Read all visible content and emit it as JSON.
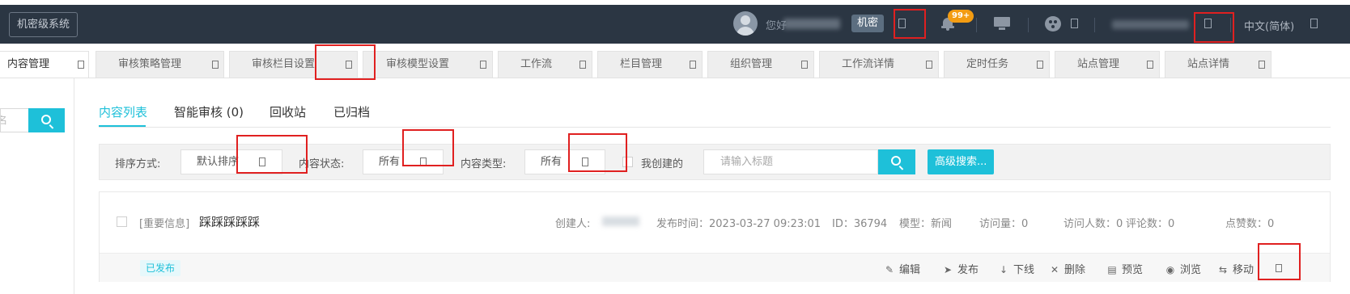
{
  "topbar": {
    "system_button": "机密级系统",
    "greeting": "您好",
    "security_level": "机密",
    "notification_count": "99+",
    "language": "中文(简体)"
  },
  "tabs": [
    {
      "label": "内容管理",
      "active": true
    },
    {
      "label": "审核策略管理",
      "active": false
    },
    {
      "label": "审核栏目设置",
      "active": false
    },
    {
      "label": "审核模型设置",
      "active": false
    },
    {
      "label": "工作流",
      "active": false
    },
    {
      "label": "栏目管理",
      "active": false
    },
    {
      "label": "组织管理",
      "active": false
    },
    {
      "label": "工作流详情",
      "active": false
    },
    {
      "label": "定时任务",
      "active": false
    },
    {
      "label": "站点管理",
      "active": false
    },
    {
      "label": "站点详情",
      "active": false
    }
  ],
  "sidebar": {
    "search_placeholder": "名"
  },
  "subtabs": [
    {
      "label": "内容列表",
      "active": true
    },
    {
      "label": "智能审核 (0)",
      "active": false
    },
    {
      "label": "回收站",
      "active": false
    },
    {
      "label": "已归档",
      "active": false
    }
  ],
  "filters": {
    "sort_label": "排序方式:",
    "sort_value": "默认排序",
    "status_label": "内容状态:",
    "status_value": "所有",
    "type_label": "内容类型:",
    "type_value": "所有",
    "mine_label": "我创建的",
    "title_placeholder": "请输入标题",
    "advanced_search": "高级搜索..."
  },
  "content_item": {
    "tag": "[重要信息]",
    "title": "踩踩踩踩踩",
    "creator_label": "创建人:",
    "publish_time": "发布时间：2023-03-27 09:23:01",
    "id": "ID：36794",
    "model": "模型：新闻",
    "visits": "访问量：0",
    "visitors": "访问人数：0",
    "comments": "评论数：0",
    "likes": "点赞数：0",
    "status": "已发布",
    "actions": {
      "edit": "编辑",
      "publish": "发布",
      "offline": "下线",
      "delete": "删除",
      "preview": "预览",
      "browse": "浏览",
      "move": "移动"
    }
  },
  "colors": {
    "topbar_bg": "#2b3643",
    "accent": "#1ec0d9",
    "badge": "#f39c12",
    "highlight_box": "#e02020"
  }
}
